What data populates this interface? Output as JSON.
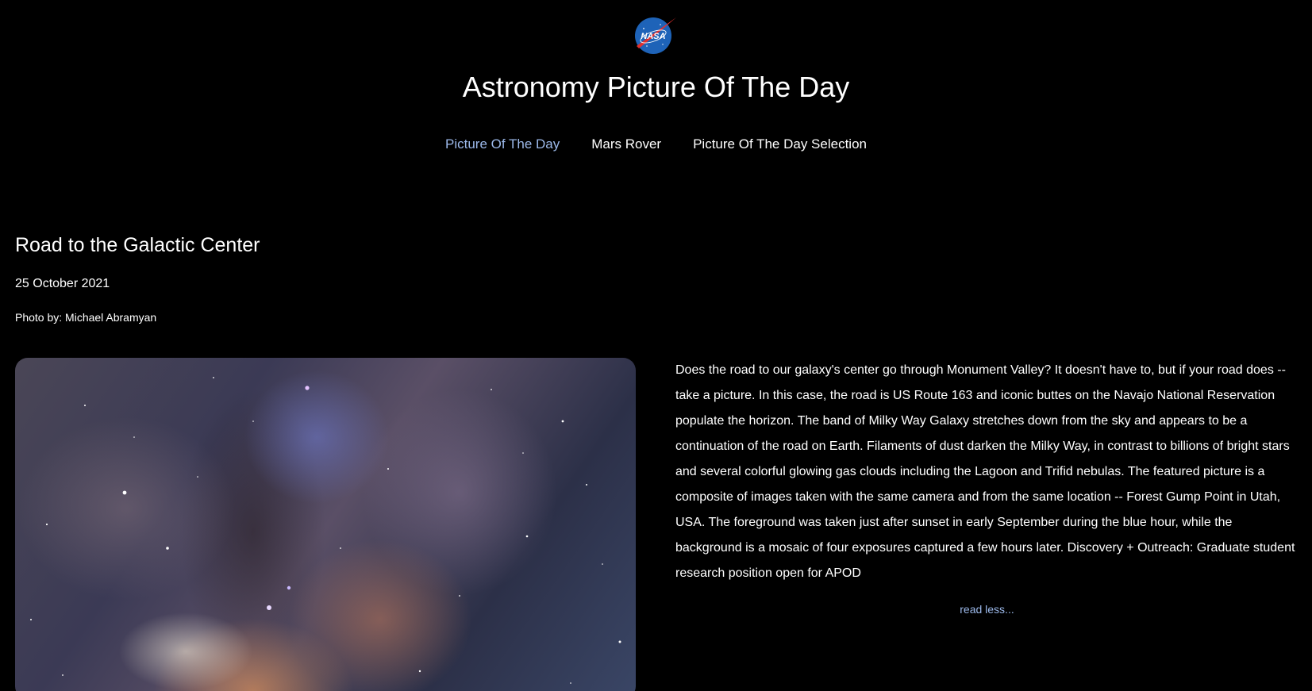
{
  "header": {
    "logo_text": "NASA",
    "title": "Astronomy Picture Of The Day"
  },
  "nav": {
    "items": [
      {
        "label": "Picture Of The Day",
        "active": true
      },
      {
        "label": "Mars Rover",
        "active": false
      },
      {
        "label": "Picture Of The Day Selection",
        "active": false
      }
    ]
  },
  "apod": {
    "title": "Road to the Galactic Center",
    "date": "25 October 2021",
    "credit": "Photo by: Michael Abramyan",
    "description": "Does the road to our galaxy's center go through Monument Valley? It doesn't have to, but if your road does -- take a picture. In this case, the road is US Route 163 and iconic buttes on the Navajo National Reservation populate the horizon. The band of Milky Way Galaxy stretches down from the sky and appears to be a continuation of the road on Earth. Filaments of dust darken the Milky Way, in contrast to billions of bright stars and several colorful glowing gas clouds including the Lagoon and Trifid nebulas. The featured picture is a composite of images taken with the same camera and from the same location -- Forest Gump Point in Utah, USA. The foreground was taken just after sunset in early September during the blue hour, while the background is a mosaic of four exposures captured a few hours later. Discovery + Outreach: Graduate student research position open for APOD",
    "toggle_label": "read less..."
  },
  "colors": {
    "background": "#000000",
    "text": "#ffffff",
    "accent": "#9cb9ea",
    "logo_blue": "#1e63b8",
    "logo_red": "#e0302e"
  }
}
